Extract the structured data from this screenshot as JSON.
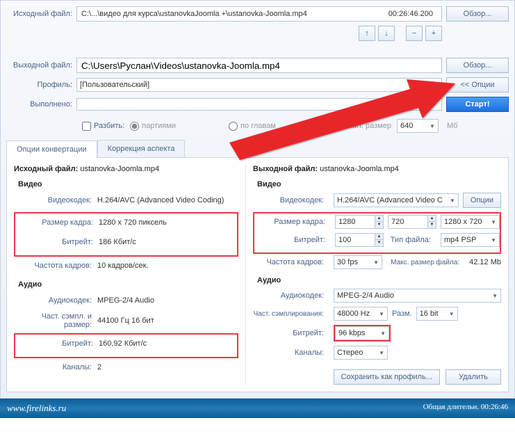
{
  "header": {
    "source_label": "Исходный файл:",
    "source_path": "C:\\...\\видео для курса\\ustanovkaJoomla +\\ustanovka-Joomla.mp4",
    "source_duration": "00:26:46.200",
    "output_label": "Выходной файл:",
    "output_path": "C:\\Users\\Руслан\\Videos\\ustanovka-Joomla.mp4",
    "profile_label": "Профиль:",
    "profile_value": "[Пользовательский]",
    "done_label": "Выполнено:",
    "browse": "Обзор...",
    "options": "<< Опции",
    "start": "Старт!",
    "up": "↑",
    "down": "↓",
    "minus": "−",
    "plus": "+"
  },
  "split": {
    "split_label": "Разбить:",
    "by_parts": "партиями",
    "by_chapters": "по главам",
    "limit_size": "лимит. размер",
    "size_value": "640",
    "size_unit": "Мб"
  },
  "tabs": {
    "convert": "Опции конвертации",
    "aspect": "Коррекция аспекта"
  },
  "left": {
    "title_prefix": "Исходный файл:",
    "filename": "ustanovka-Joomla.mp4",
    "video": "Видео",
    "audio": "Аудио",
    "codec_label": "Видеокодек:",
    "codec_val": "H.264/AVC (Advanced Video Coding)",
    "frame_label": "Размер кадра:",
    "frame_val": "1280 x 720 пиксель",
    "bitrate_label": "Битрейт:",
    "bitrate_val": "186 Кбит/с",
    "fps_label": "Частота кадров:",
    "fps_val": "10 кадров/сек.",
    "acodec_label": "Аудиокодек:",
    "acodec_val": "MPEG-2/4 Audio",
    "sample_label": "Част. сэмпл. и размер:",
    "sample_val": "44100 Гц 16 бит",
    "abitrate_label": "Битрейт:",
    "abitrate_val": "160,92 Кбит/с",
    "channels_label": "Каналы:",
    "channels_val": "2"
  },
  "right": {
    "title_prefix": "Выходной файл:",
    "filename": "ustanovka-Joomla.mp4",
    "video": "Видео",
    "audio": "Аудио",
    "codec_label": "Видеокодек:",
    "codec_val": "H.264/AVC (Advanced Video C",
    "options_btn": "Опции",
    "frame_label": "Размер кадра:",
    "frame_w": "1280",
    "frame_h": "720",
    "frame_preset": "1280 x 720",
    "bitrate_label": "Битрейт:",
    "bitrate_val": "100",
    "filetype_label": "Тип файла:",
    "filetype_val": "mp4 PSP",
    "fps_label": "Частота кадров:",
    "fps_val": "30 fps",
    "maxsize_label": "Макс. размер файла:",
    "maxsize_val": "42.12 Mb",
    "acodec_label": "Аудиокодек:",
    "acodec_val": "MPEG-2/4 Audio",
    "asample_label": "Част. сэмплирования:",
    "asample_val": "48000 Hz",
    "abit_label": "Разм.",
    "abit_val": "16 bit",
    "abitrate_label": "Битрейт:",
    "abitrate_val": "96 kbps",
    "channels_label": "Каналы:",
    "channels_val": "Стерео",
    "save_profile": "Сохранить как профиль...",
    "delete": "Удалить"
  },
  "footer": {
    "site": "www.firelinks.ru",
    "duration_label": "Общая длительн.",
    "duration_val": "00:26:46"
  }
}
